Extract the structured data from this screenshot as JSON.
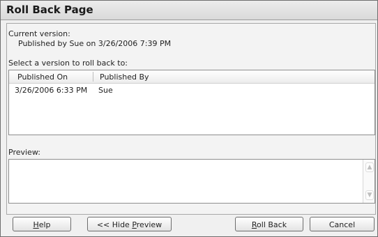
{
  "window": {
    "title": "Roll Back Page"
  },
  "current": {
    "label": "Current version:",
    "value": "Published by Sue on 3/26/2006 7:39 PM"
  },
  "select": {
    "label": "Select a version to roll back to:",
    "columns": [
      "Published On",
      "Published By"
    ],
    "rows": [
      {
        "published_on": "3/26/2006 6:33 PM",
        "published_by": "Sue"
      }
    ]
  },
  "preview": {
    "label": "Preview:",
    "content": ""
  },
  "buttons": {
    "help": {
      "mnemonic": "H",
      "rest": "elp"
    },
    "hide_preview": {
      "prefix": "<< Hide ",
      "mnemonic": "P",
      "rest": "review"
    },
    "roll_back": {
      "mnemonic": "R",
      "rest": "oll Back"
    },
    "cancel": "Cancel"
  },
  "icons": {
    "scroll_up": "scroll-up-arrow-icon",
    "scroll_down": "scroll-down-arrow-icon"
  }
}
